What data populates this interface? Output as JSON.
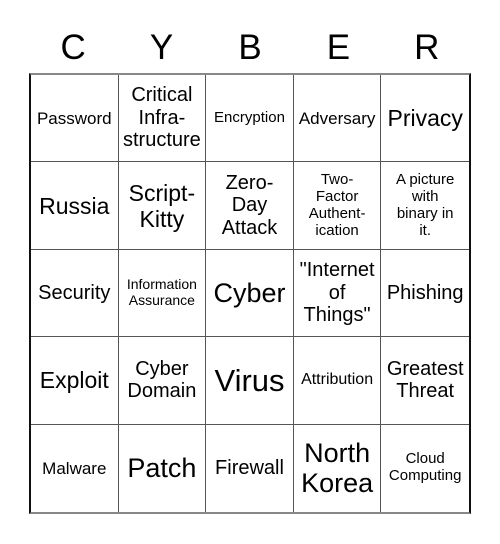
{
  "title_letters": [
    "C",
    "Y",
    "B",
    "E",
    "R"
  ],
  "cells": [
    [
      "Password",
      "Critical\nInfra-\nstructure",
      "Encryption",
      "Adversary",
      "Privacy"
    ],
    [
      "Russia",
      "Script-\nKitty",
      "Zero-\nDay\nAttack",
      "Two-\nFactor\nAuthent-\nication",
      "A picture\nwith\nbinary in\nit."
    ],
    [
      "Security",
      "Information\nAssurance",
      "Cyber",
      "\"Internet\nof\nThings\"",
      "Phishing"
    ],
    [
      "Exploit",
      "Cyber\nDomain",
      "Virus",
      "Attribution",
      "Greatest\nThreat"
    ],
    [
      "Malware",
      "Patch",
      "Firewall",
      "North\nKorea",
      "Cloud\nComputing"
    ]
  ]
}
